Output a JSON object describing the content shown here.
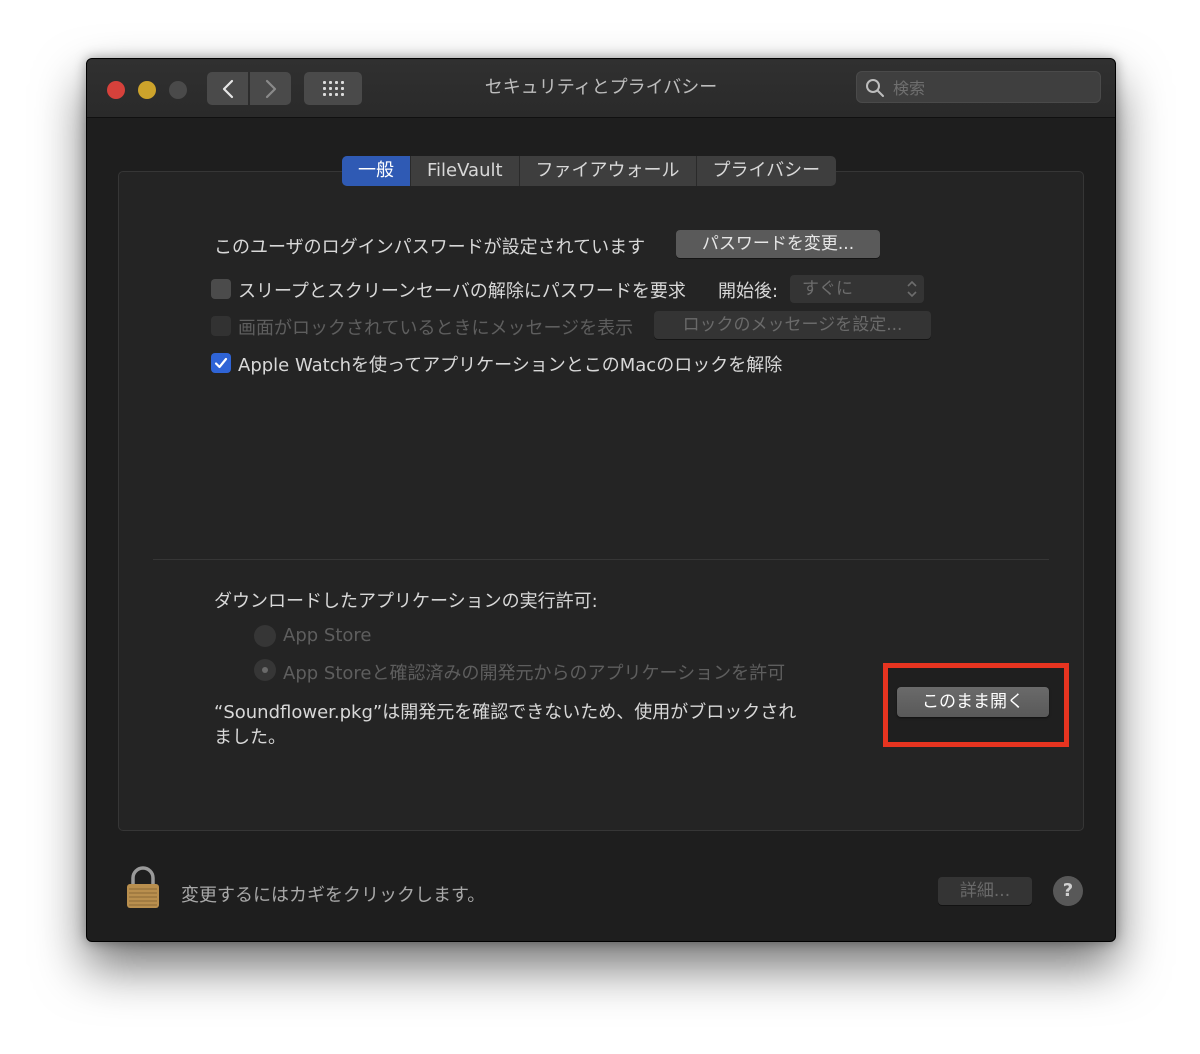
{
  "window": {
    "title": "セキュリティとプライバシー",
    "search_placeholder": "検索"
  },
  "tabs": [
    {
      "label": "一般",
      "active": true
    },
    {
      "label": "FileVault",
      "active": false
    },
    {
      "label": "ファイアウォール",
      "active": false
    },
    {
      "label": "プライバシー",
      "active": false
    }
  ],
  "general": {
    "password_text": "このユーザのログインパスワードが設定されています",
    "change_password_button": "パスワードを変更...",
    "require_password_label": "スリープとスクリーンセーバの解除にパスワードを要求",
    "require_password_checked": false,
    "after_label": "開始後:",
    "after_value": "すぐに",
    "lock_message_label": "画面がロックされているときにメッセージを表示",
    "lock_message_checked": false,
    "lock_message_button": "ロックのメッセージを設定...",
    "apple_watch_label": "Apple Watchを使ってアプリケーションとこのMacのロックを解除",
    "apple_watch_checked": true
  },
  "downloads": {
    "heading": "ダウンロードしたアプリケーションの実行許可:",
    "options": [
      {
        "label": "App Store",
        "selected": false
      },
      {
        "label": "App Storeと確認済みの開発元からのアプリケーションを許可",
        "selected": true
      }
    ],
    "blocked_line1": "“Soundflower.pkg”は開発元を確認できないため、使用がブロックされ",
    "blocked_line2": "ました。",
    "open_anyway_button": "このまま開く"
  },
  "footer": {
    "lock_text": "変更するにはカギをクリックします。",
    "advanced_button": "詳細...",
    "help_label": "?"
  },
  "colors": {
    "accent_blue": "#2f5ab4",
    "highlight_red": "#e73420",
    "close": "#d6413b",
    "minimize": "#cda32b"
  }
}
